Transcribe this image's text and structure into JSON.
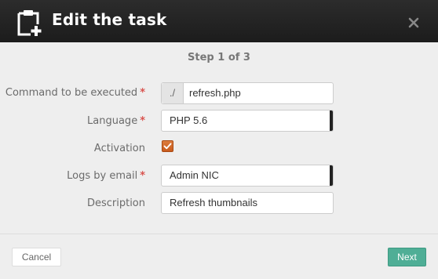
{
  "dialog": {
    "title": "Edit the task",
    "icons": {
      "header": "clipboard-add-icon",
      "close": "close-icon"
    }
  },
  "step": "Step 1 of 3",
  "form": {
    "command": {
      "label": "Command to be executed",
      "required_mark": "*",
      "prefix": "./",
      "value": "refresh.php"
    },
    "language": {
      "label": "Language",
      "required_mark": "*",
      "value": "PHP 5.6"
    },
    "activation": {
      "label": "Activation",
      "checked": true
    },
    "logs_by_email": {
      "label": "Logs by email",
      "required_mark": "*",
      "value": "Admin NIC"
    },
    "description": {
      "label": "Description",
      "value": "Refresh thumbnails"
    }
  },
  "footer": {
    "cancel_label": "Cancel",
    "next_label": "Next"
  },
  "colors": {
    "header_bg": "#222222",
    "required": "#d9534f",
    "checkbox": "#d2691e",
    "primary": "#4fae96"
  }
}
